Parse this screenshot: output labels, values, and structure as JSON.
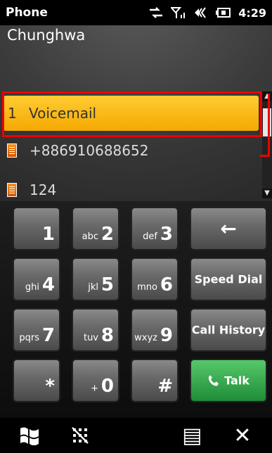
{
  "status_bar": {
    "app_title": "Phone",
    "time": "4:29",
    "icons": [
      "data-sync-icon",
      "signal-icon",
      "volume-icon",
      "battery-charging-icon"
    ]
  },
  "carrier": "Chunghwa",
  "list": {
    "items": [
      {
        "index": "1",
        "label": "Voicemail",
        "selected": true
      },
      {
        "label": "+886910688652",
        "icon": "contact-card-icon"
      },
      {
        "label": "124",
        "icon": "contact-card-icon"
      }
    ]
  },
  "keypad": {
    "keys": [
      {
        "digit": "1",
        "letters": ""
      },
      {
        "digit": "2",
        "letters": "abc"
      },
      {
        "digit": "3",
        "letters": "def"
      },
      {
        "digit": "4",
        "letters": "ghi"
      },
      {
        "digit": "5",
        "letters": "jkl"
      },
      {
        "digit": "6",
        "letters": "mno"
      },
      {
        "digit": "7",
        "letters": "pqrs"
      },
      {
        "digit": "8",
        "letters": "tuv"
      },
      {
        "digit": "9",
        "letters": "wxyz"
      },
      {
        "digit": "*",
        "letters": ""
      },
      {
        "digit": "0",
        "letters": "+"
      },
      {
        "digit": "#",
        "letters": ""
      }
    ],
    "backspace_glyph": "←",
    "speed_dial_label": "Speed Dial",
    "call_history_label": "Call History",
    "talk_label": "Talk",
    "talk_color": "#2fa84a"
  },
  "bottom_bar": {
    "start_icon": "windows-flag-icon",
    "keypad_toggle_icon": "hide-keypad-icon",
    "menu_icon": "menu-icon",
    "close_icon": "close-icon",
    "close_glyph": "✕",
    "menu_glyph": "▤"
  },
  "colors": {
    "selection": "#f5b400",
    "annotation_red": "#e00000"
  }
}
